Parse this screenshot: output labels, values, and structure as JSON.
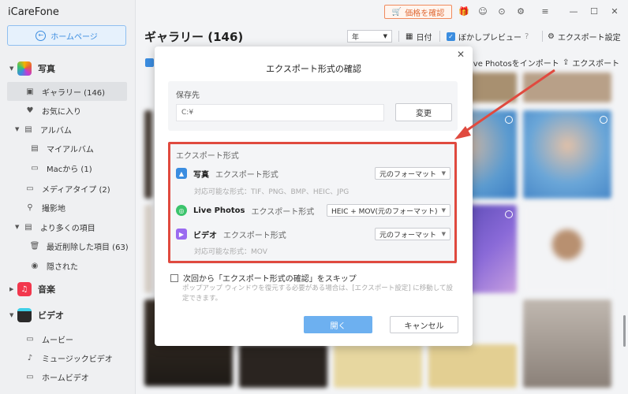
{
  "app": {
    "title": "iCareFone",
    "home_button": "ホームページ"
  },
  "sidebar": {
    "photos_section": "写真",
    "gallery": "ギャラリー (146)",
    "favorites": "お気に入り",
    "albums": "アルバム",
    "my_album": "マイアルバム",
    "from_mac": "Macから (1)",
    "media_type": "メディアタイプ (2)",
    "places": "撮影地",
    "more_items": "より多くの項目",
    "recently_deleted": "最近削除した項目 (63)",
    "hidden": "隠された",
    "music_section": "音楽",
    "video_section": "ビデオ",
    "movies": "ムービー",
    "music_videos": "ミュージックビデオ",
    "home_videos": "ホームビデオ"
  },
  "topbar": {
    "price_button": "価格を確認"
  },
  "header": {
    "title": "ギャラリー (146)",
    "year_select": "年",
    "date_label": "日付",
    "blur_preview": "ぼかしプレビュー",
    "export_settings": "エクスポート設定",
    "import_live": "ive Photosをインポート",
    "export": "エクスポート"
  },
  "dialog": {
    "title": "エクスポート形式の確認",
    "save_label": "保存先",
    "path_value": "C:¥",
    "change_button": "変更",
    "export_format_heading": "エクスポート形式",
    "photo_label": "写真",
    "photo_suffix": "エクスポート形式",
    "photo_select": "元のフォーマット",
    "photo_supported": "対応可能な形式：TIF、PNG、BMP、HEIC、JPG",
    "live_label": "Live Photos",
    "live_suffix": "エクスポート形式",
    "live_select": "HEIC + MOV(元のフォーマット)",
    "video_label": "ビデオ",
    "video_suffix": "エクスポート形式",
    "video_select": "元のフォーマット",
    "video_supported": "対応可能な形式：MOV",
    "skip_label": "次回から「エクスポート形式の確認」をスキップ",
    "skip_note": "ポップアップ ウィンドウを復元する必要がある場合は、[エクスポート設定] に移動して設定できます。",
    "open_button": "開く",
    "cancel_button": "キャンセル"
  },
  "colors": {
    "accent": "#3b8de0",
    "highlight": "#e04a3f",
    "primary_button": "#6db0f0"
  }
}
